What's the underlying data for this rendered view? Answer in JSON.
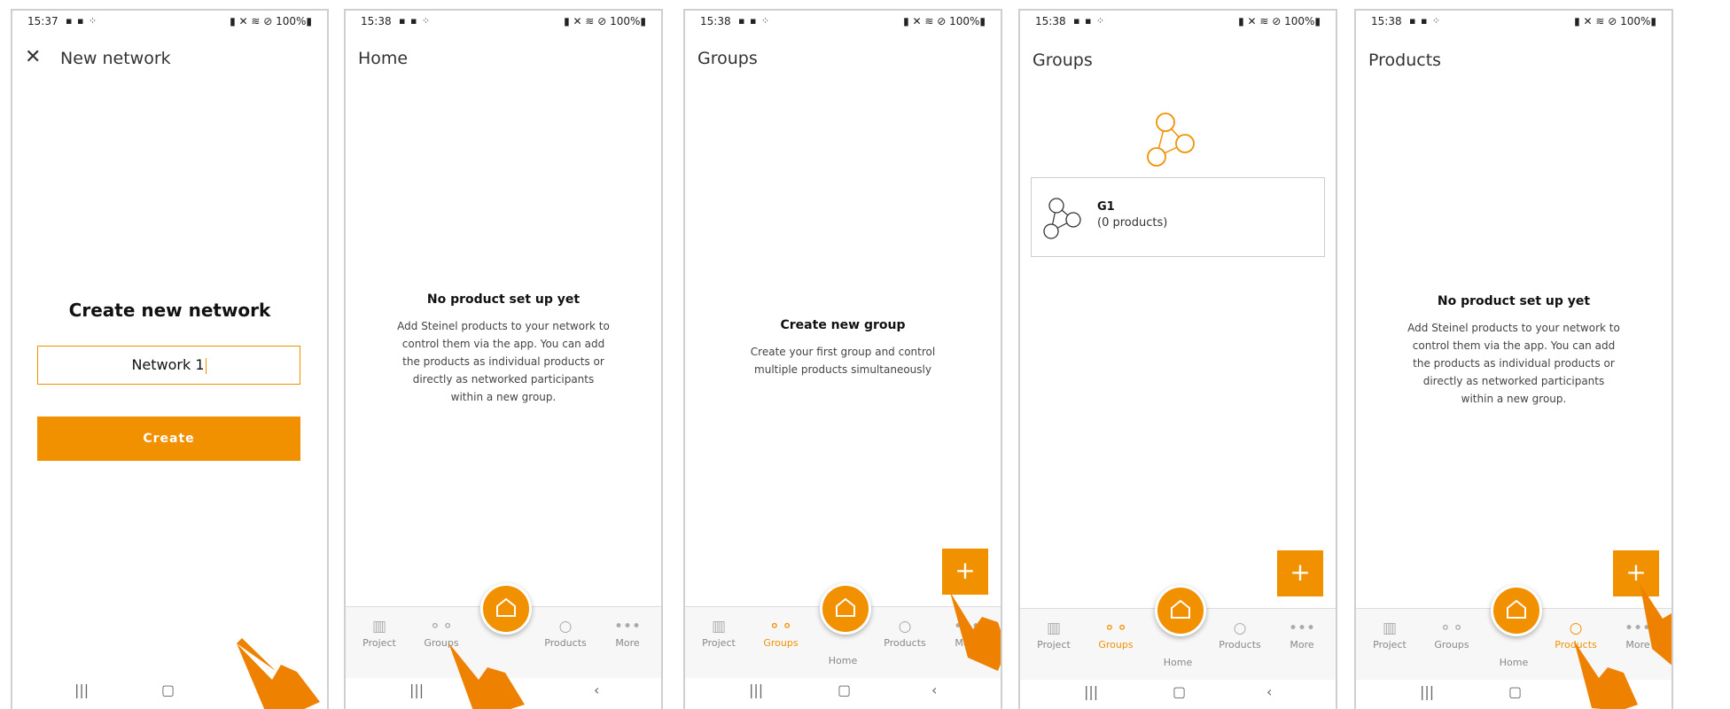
{
  "colors": {
    "accent": "#f29100",
    "border": "#cfcfcf"
  },
  "status": {
    "s1": {
      "time": "15:37",
      "icons": "▪ ▪ ⁘",
      "right": "▮ ✕ ≋ ⊘ 100%▮"
    },
    "s2": {
      "time": "15:38",
      "icons": "▪ ▪ ⁘",
      "right": "▮ ✕ ≋ ⊘ 100%▮"
    }
  },
  "screen1": {
    "title": "New network",
    "heading": "Create new network",
    "input_value": "Network 1",
    "button": "Create"
  },
  "screen2": {
    "title": "Home",
    "empty_title": "No product set up yet",
    "empty_text": "Add Steinel products to your network to control them via the app. You can add the products as individual products or directly as networked participants within a new group."
  },
  "screen3": {
    "title": "Groups",
    "empty_title": "Create new group",
    "empty_text": "Create your first group and control multiple products simultaneously"
  },
  "screen4": {
    "title": "Groups",
    "group_name": "G1",
    "group_count": "(0 products)"
  },
  "screen5": {
    "title": "Products",
    "empty_title": "No product set up yet",
    "empty_text": "Add Steinel products to your network to control them via the app. You can add the products as individual products or directly as networked participants within a new group."
  },
  "nav": {
    "project": "Project",
    "groups": "Groups",
    "home": "Home",
    "products": "Products",
    "more": "More"
  },
  "fab": {
    "plus": "+"
  }
}
